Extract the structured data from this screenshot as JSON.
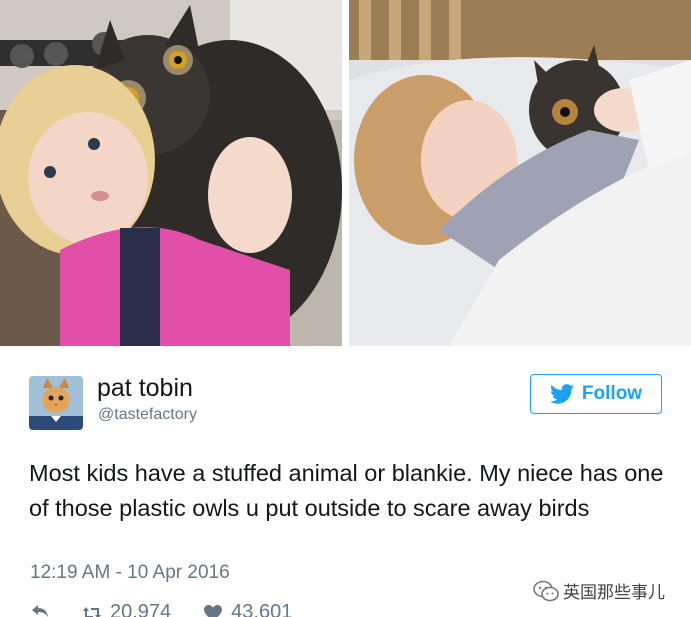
{
  "tweet": {
    "author_name": "pat tobin",
    "author_handle": "@tastefactory",
    "follow_label": "Follow",
    "text": "Most kids have a stuffed animal or blankie. My niece has one of those plastic owls u put outside to scare away birds",
    "timestamp": "12:19 AM - 10 Apr 2016",
    "retweets": "20,974",
    "likes": "43,601"
  },
  "watermark": {
    "text": "英国那些事儿"
  },
  "icons": {
    "reply": "reply-icon",
    "retweet": "retweet-icon",
    "like": "heart-icon",
    "follow": "twitter-bird-icon",
    "watermark": "wechat-icon"
  },
  "colors": {
    "accent": "#1da1f2",
    "text": "#14171a",
    "muted": "#657786"
  }
}
